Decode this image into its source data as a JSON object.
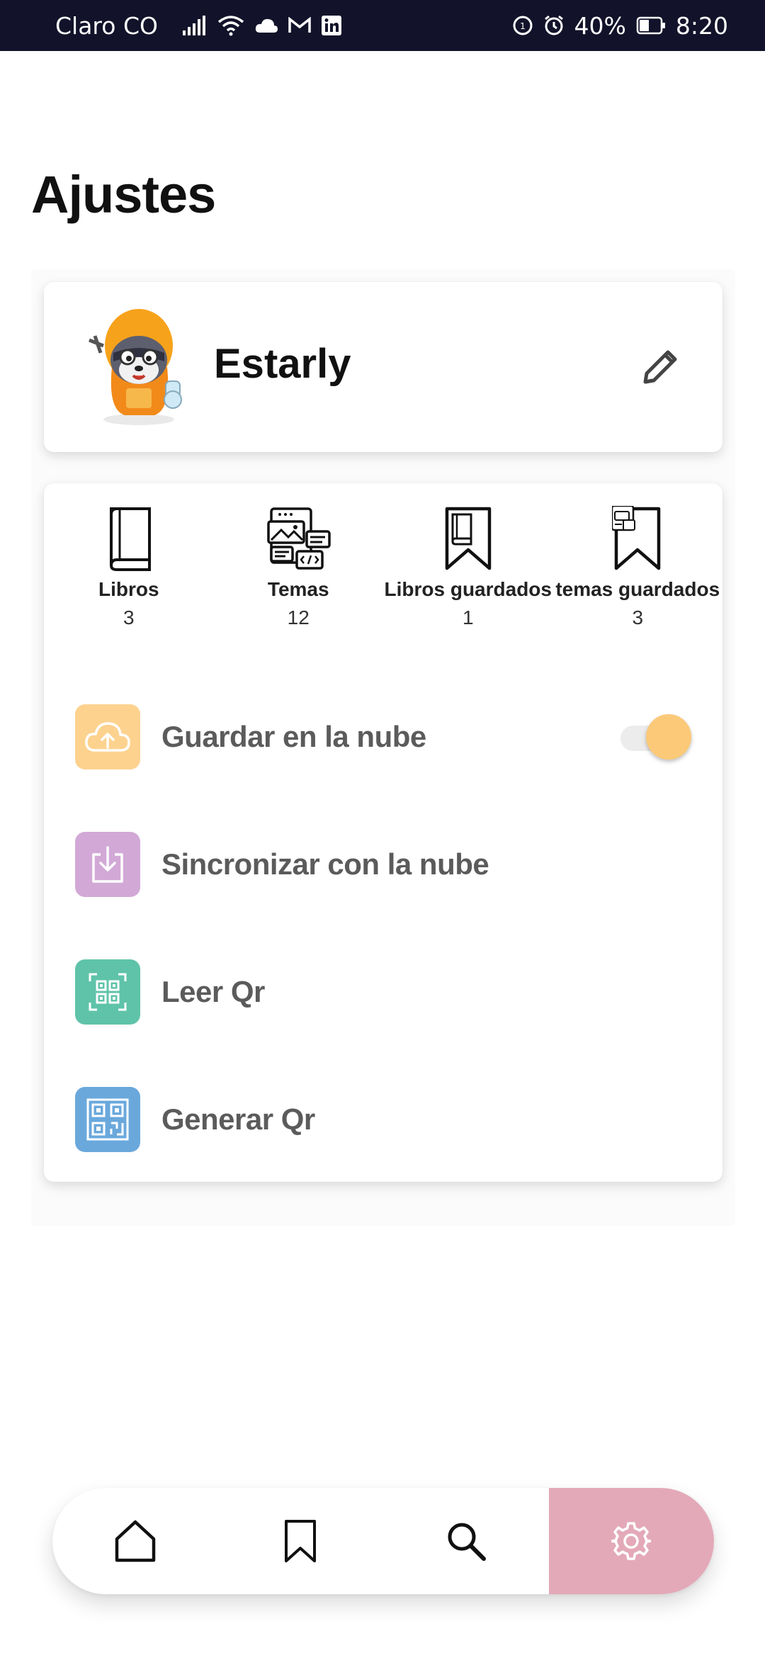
{
  "status_bar": {
    "carrier": "Claro CO",
    "battery": "40%",
    "time": "8:20"
  },
  "page_title": "Ajustes",
  "profile": {
    "name": "Estarly"
  },
  "stats": [
    {
      "label": "Libros",
      "value": "3",
      "icon": "book-icon"
    },
    {
      "label": "Temas",
      "value": "12",
      "icon": "topics-icon"
    },
    {
      "label": "Libros guardados",
      "value": "1",
      "icon": "saved-books-icon"
    },
    {
      "label": "temas guardados",
      "value": "3",
      "icon": "saved-topics-icon"
    }
  ],
  "options": {
    "cloud_save": {
      "label": "Guardar en la nube",
      "enabled": true,
      "color": "#fdd28f"
    },
    "cloud_sync": {
      "label": "Sincronizar con la nube",
      "color": "#d2a9d6"
    },
    "read_qr": {
      "label": "Leer Qr",
      "color": "#5fc3a9"
    },
    "generate_qr": {
      "label": "Generar Qr",
      "color": "#6aa8dc"
    }
  },
  "nav": {
    "items": [
      "home-icon",
      "bookmark-icon",
      "search-icon",
      "gear-icon"
    ],
    "active": "gear-icon",
    "active_color": "#e3a9b9"
  }
}
